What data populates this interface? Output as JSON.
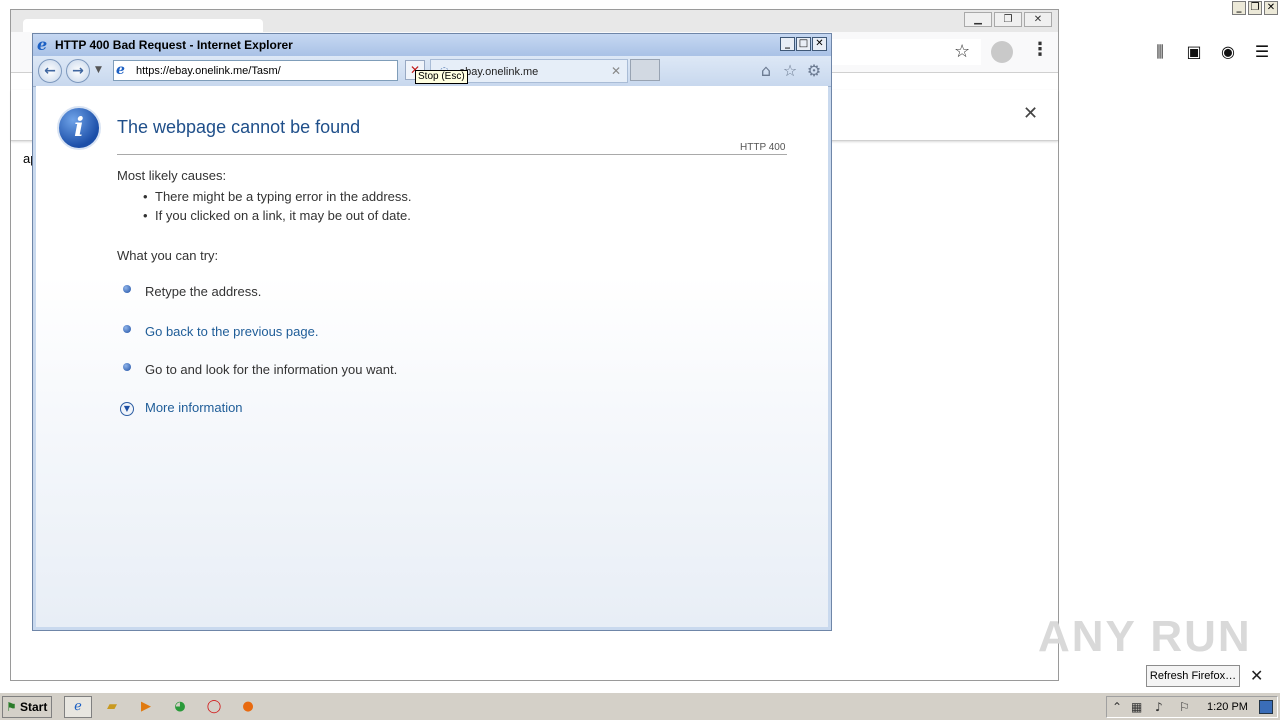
{
  "ie": {
    "title": "HTTP 400 Bad Request - Internet Explorer",
    "address": "https://ebay.onelink.me/Tasm/",
    "stop_tooltip": "Stop (Esc)",
    "tab_label": "ebay.onelink.me",
    "controls": {
      "minimize": "_",
      "maximize": "□",
      "close": "✕"
    }
  },
  "page": {
    "title": "The webpage cannot be found",
    "code": "HTTP 400",
    "causes_heading": "Most likely causes:",
    "causes": [
      "There might be a typing error in the address.",
      "If you clicked on a link, it may be out of date."
    ],
    "try_heading": "What you can try:",
    "try_items": [
      "Retype the address.",
      "Go back to the previous page.",
      "Go to  and look for the information you want."
    ],
    "more_info": "More information"
  },
  "firefox": {
    "left_text": "ap",
    "refresh_button": "Refresh Firefox…"
  },
  "watermark": "ANY RUN",
  "taskbar": {
    "start": "Start",
    "clock": "1:20 PM"
  },
  "colors": {
    "title_blue": "#1f4f8a",
    "link_blue": "#1f5d98",
    "taskbar": "#d4d0c8"
  }
}
